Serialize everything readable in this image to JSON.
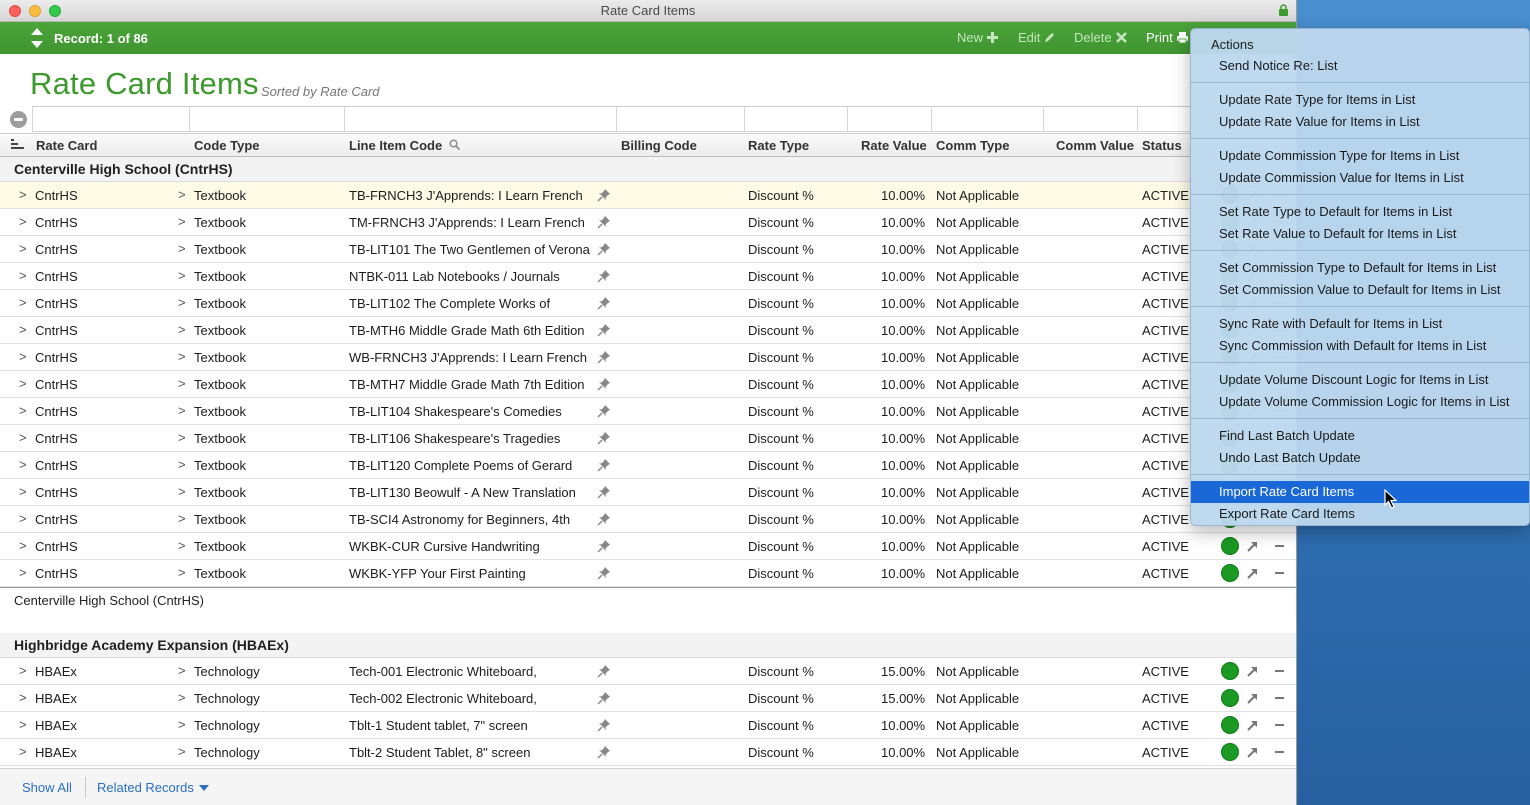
{
  "window": {
    "title": "Rate Card Items"
  },
  "toolbar": {
    "record_label": "Record: 1 of 86",
    "new_label": "New",
    "edit_label": "Edit",
    "delete_label": "Delete",
    "print_label": "Print"
  },
  "page": {
    "title": "Rate Card Items",
    "sort_label": "Sorted by Rate Card"
  },
  "columns": [
    "Rate Card",
    "Code Type",
    "Line Item Code",
    "Billing Code",
    "Rate Type",
    "Rate Value",
    "Comm Type",
    "Comm Value",
    "Status"
  ],
  "groups": [
    {
      "header": "Centerville High School  (CntrHS)",
      "footer": "Centerville High School  (CntrHS)",
      "rows": [
        {
          "rate_card": "CntrHS",
          "code_type": "Textbook",
          "line_item": "TB-FRNCH3 J'Apprends: I Learn French",
          "rate_type": "Discount %",
          "rate_value": "10.00%",
          "comm_type": "Not Applicable",
          "status": "ACTIVE"
        },
        {
          "rate_card": "CntrHS",
          "code_type": "Textbook",
          "line_item": "TM-FRNCH3 J'Apprends: I Learn French",
          "rate_type": "Discount %",
          "rate_value": "10.00%",
          "comm_type": "Not Applicable",
          "status": "ACTIVE"
        },
        {
          "rate_card": "CntrHS",
          "code_type": "Textbook",
          "line_item": "TB-LIT101 The Two Gentlemen of Verona",
          "rate_type": "Discount %",
          "rate_value": "10.00%",
          "comm_type": "Not Applicable",
          "status": "ACTIVE"
        },
        {
          "rate_card": "CntrHS",
          "code_type": "Textbook",
          "line_item": "NTBK-011 Lab Notebooks / Journals",
          "rate_type": "Discount %",
          "rate_value": "10.00%",
          "comm_type": "Not Applicable",
          "status": "ACTIVE"
        },
        {
          "rate_card": "CntrHS",
          "code_type": "Textbook",
          "line_item": "TB-LIT102 The Complete Works of",
          "rate_type": "Discount %",
          "rate_value": "10.00%",
          "comm_type": "Not Applicable",
          "status": "ACTIVE"
        },
        {
          "rate_card": "CntrHS",
          "code_type": "Textbook",
          "line_item": "TB-MTH6 Middle Grade Math 6th Edition",
          "rate_type": "Discount %",
          "rate_value": "10.00%",
          "comm_type": "Not Applicable",
          "status": "ACTIVE"
        },
        {
          "rate_card": "CntrHS",
          "code_type": "Textbook",
          "line_item": "WB-FRNCH3 J'Apprends: I Learn French",
          "rate_type": "Discount %",
          "rate_value": "10.00%",
          "comm_type": "Not Applicable",
          "status": "ACTIVE"
        },
        {
          "rate_card": "CntrHS",
          "code_type": "Textbook",
          "line_item": "TB-MTH7 Middle Grade Math 7th Edition",
          "rate_type": "Discount %",
          "rate_value": "10.00%",
          "comm_type": "Not Applicable",
          "status": "ACTIVE"
        },
        {
          "rate_card": "CntrHS",
          "code_type": "Textbook",
          "line_item": "TB-LIT104 Shakespeare's Comedies",
          "rate_type": "Discount %",
          "rate_value": "10.00%",
          "comm_type": "Not Applicable",
          "status": "ACTIVE"
        },
        {
          "rate_card": "CntrHS",
          "code_type": "Textbook",
          "line_item": "TB-LIT106 Shakespeare's Tragedies",
          "rate_type": "Discount %",
          "rate_value": "10.00%",
          "comm_type": "Not Applicable",
          "status": "ACTIVE"
        },
        {
          "rate_card": "CntrHS",
          "code_type": "Textbook",
          "line_item": "TB-LIT120 Complete Poems of Gerard",
          "rate_type": "Discount %",
          "rate_value": "10.00%",
          "comm_type": "Not Applicable",
          "status": "ACTIVE"
        },
        {
          "rate_card": "CntrHS",
          "code_type": "Textbook",
          "line_item": "TB-LIT130 Beowulf - A New Translation",
          "rate_type": "Discount %",
          "rate_value": "10.00%",
          "comm_type": "Not Applicable",
          "status": "ACTIVE"
        },
        {
          "rate_card": "CntrHS",
          "code_type": "Textbook",
          "line_item": "TB-SCI4 Astronomy for Beginners, 4th",
          "rate_type": "Discount %",
          "rate_value": "10.00%",
          "comm_type": "Not Applicable",
          "status": "ACTIVE"
        },
        {
          "rate_card": "CntrHS",
          "code_type": "Textbook",
          "line_item": "WKBK-CUR Cursive Handwriting",
          "rate_type": "Discount %",
          "rate_value": "10.00%",
          "comm_type": "Not Applicable",
          "status": "ACTIVE"
        },
        {
          "rate_card": "CntrHS",
          "code_type": "Textbook",
          "line_item": "WKBK-YFP Your First Painting",
          "rate_type": "Discount %",
          "rate_value": "10.00%",
          "comm_type": "Not Applicable",
          "status": "ACTIVE"
        }
      ]
    },
    {
      "header": "Highbridge Academy Expansion  (HBAEx)",
      "rows": [
        {
          "rate_card": "HBAEx",
          "code_type": "Technology",
          "line_item": "Tech-001 Electronic Whiteboard,",
          "rate_type": "Discount %",
          "rate_value": "15.00%",
          "comm_type": "Not Applicable",
          "status": "ACTIVE"
        },
        {
          "rate_card": "HBAEx",
          "code_type": "Technology",
          "line_item": "Tech-002 Electronic Whiteboard,",
          "rate_type": "Discount %",
          "rate_value": "15.00%",
          "comm_type": "Not Applicable",
          "status": "ACTIVE"
        },
        {
          "rate_card": "HBAEx",
          "code_type": "Technology",
          "line_item": "Tblt-1 Student tablet, 7\" screen",
          "rate_type": "Discount %",
          "rate_value": "10.00%",
          "comm_type": "Not Applicable",
          "status": "ACTIVE"
        },
        {
          "rate_card": "HBAEx",
          "code_type": "Technology",
          "line_item": "Tblt-2 Student Tablet, 8\" screen",
          "rate_type": "Discount %",
          "rate_value": "10.00%",
          "comm_type": "Not Applicable",
          "status": "ACTIVE"
        }
      ]
    }
  ],
  "footer": {
    "show_all": "Show All",
    "related_records": "Related Records"
  },
  "menu": {
    "title": "Actions",
    "sections": [
      [
        "Send Notice Re: List"
      ],
      [
        "Update Rate Type for Items in List",
        "Update Rate Value for Items in List"
      ],
      [
        "Update Commission Type for Items in List",
        "Update Commission Value for Items in List"
      ],
      [
        "Set Rate Type to Default for Items in List",
        "Set Rate Value to Default for Items in List"
      ],
      [
        "Set Commission Type to Default for Items in List",
        "Set Commission Value to Default for Items in List"
      ],
      [
        "Sync Rate with Default for Items in List",
        "Sync Commission with Default for Items in List"
      ],
      [
        "Update Volume Discount Logic for Items in List",
        "Update Volume Commission Logic for Items in List"
      ],
      [
        "Find Last Batch Update",
        "Undo Last Batch Update"
      ],
      [
        "Import Rate Card Items",
        "Export Rate Card Items"
      ]
    ],
    "highlighted": "Import Rate Card Items"
  },
  "colors": {
    "toolbar_green": "#44a035",
    "title_green": "#3d9a2c",
    "status_active": "#1a9a22",
    "menu_highlight": "#1a68d8",
    "link_blue": "#2a6fc2"
  }
}
